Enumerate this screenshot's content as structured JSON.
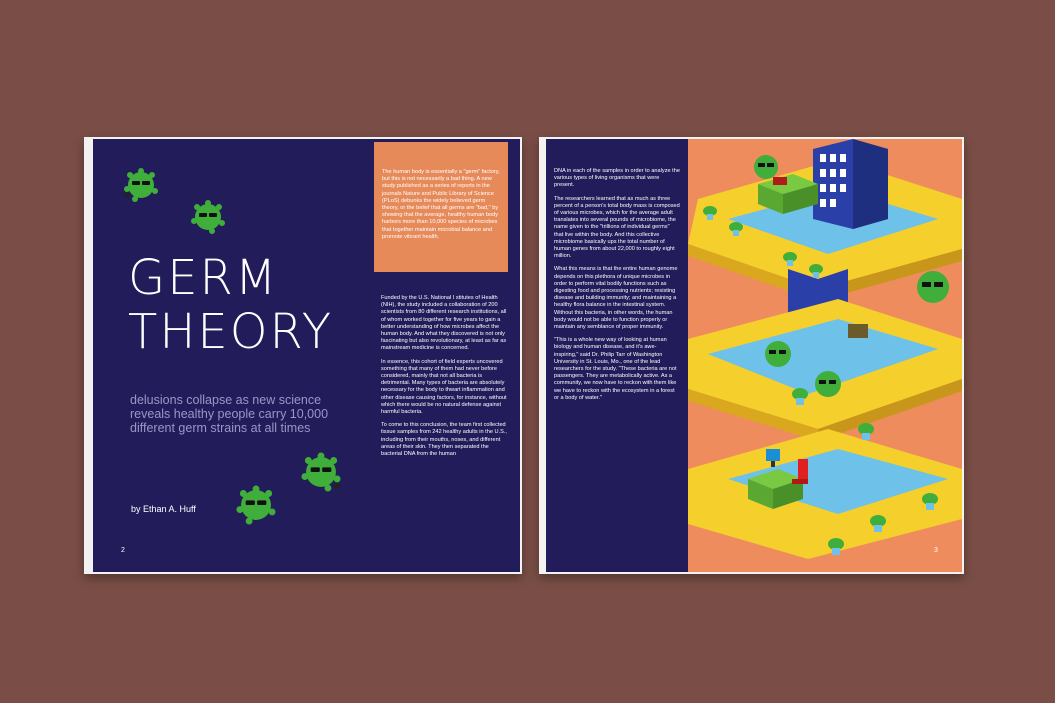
{
  "left_page": {
    "title_line1": "GERM",
    "title_line2": "THEORY",
    "subtitle": "delusions collapse as new science reveals healthy people carry 10,000 different germ strains at all times",
    "byline": "by Ethan A. Huff",
    "page_number": "2",
    "callout": "The human body is essentially a \"germ\" factory, but this is not necessarily a bad thing. A new study published as a series of reports in the journals Nature and Public Library of Science (PLoS) debunks the widely believed germ theory, or the belief that all germs are \"bad,\" by showing that the average, healthy human body harbors more than 10,000 species of microbes that together maintain microbial balance and promote vibrant health.",
    "column_paragraphs": [
      "Funded by the U.S. National I stitutes of Health (NIH), the study included a collaboration of 200 scientists from 80 different research institutions, all of whom worked together for five years to gain a better understanding of how microbes affect the human body. And what they discovered is not only fascinating but also revolutionary, at least as far as mainstream medicine is concerned.",
      "In essence, this cohort of field experts uncovered something that many of them had never before considered, mainly that not all bacteria is detrimental. Many types of bacteria are absolutely necessary for the body to thwart inflammation and other disease causing factors, for instance, without which there would be no natural defense against harmful bacteria.",
      "To come to this conclusion, the team first collected tissue samples from 242 healthy adults in the U.S., including from their mouths, noses, and different areas of their skin. They then separated the bacterial DNA from the human"
    ]
  },
  "right_page": {
    "page_number": "3",
    "column_paragraphs": [
      "DNA in each of the samples in order to analyze the various types of living organisms that were present.",
      "The researchers learned that as much as three percent of a person's total body mass is composed of various microbes, which for the average adult translates into several pounds of microbiome, the name given to the \"trillions of individual germs\" that live within the body. And this collective microbiome basically ups the total number of human genes from about 22,000 to roughly eight million.",
      "What this means is that the entire human genome depends on this plethora of unique microbes in order to perform vital bodily functions such as digesting food and processing nutrients; resisting disease and building immunity; and maintaining a healthy flora balance in the intestinal system. Without this bacteria, in other words, the human body would not be able to function properly or maintain any semblance of proper immunity.",
      "\"This is a whole new way of looking at human biology and human disease, and it's awe-inspiring,\" said Dr. Philip Tarr of Washington University in St. Louis, Mo., one of the lead researchers for the study. \"These bacteria are not passengers. They are metabolically active. As a community, we now have to reckon with them like we have to reckon with the ecosystem in a forest or a body of water.\""
    ]
  },
  "colors": {
    "background": "#7a4e46",
    "navy": "#231c5a",
    "orange": "#e78a5a",
    "illustration_bg": "#ef8c5e",
    "platform_yellow": "#f5cf2b",
    "platform_blue": "#6ec1e8",
    "germ_green": "#3fae3a"
  },
  "icons": [
    "germ-icon",
    "building-icon",
    "desk-icon",
    "plant-icon",
    "computer-icon",
    "chair-icon"
  ]
}
